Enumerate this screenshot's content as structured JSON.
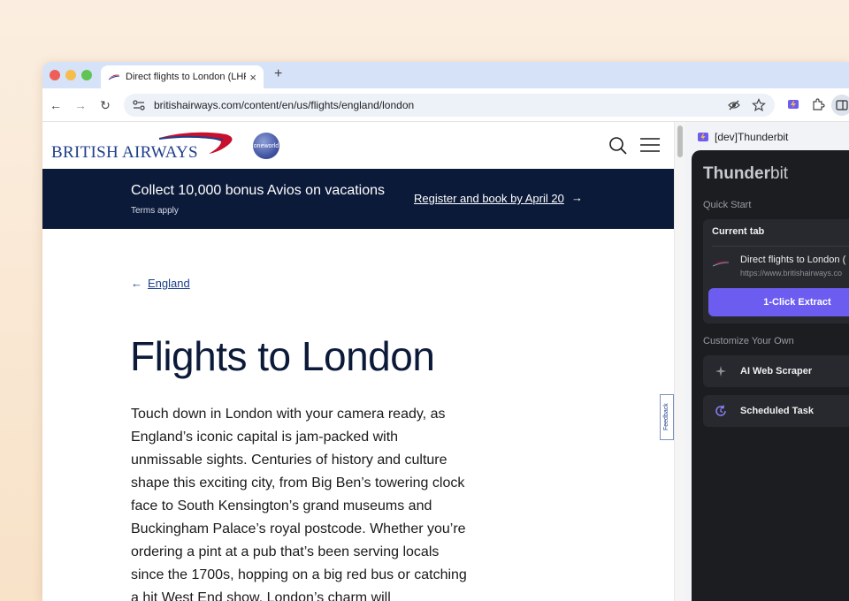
{
  "browser": {
    "tab": {
      "title": "Direct flights to London (LHR",
      "close": "×"
    },
    "new_tab": "+",
    "url": "britishairways.com/content/en/us/flights/england/london",
    "nav": {
      "back": "←",
      "forward": "→",
      "reload": "↻"
    },
    "icons": [
      "eye-off-icon",
      "star-icon",
      "thunderbit-ext-icon",
      "puzzle-icon",
      "side-panel-icon"
    ]
  },
  "ba": {
    "logo_text": "BRITISH AIRWAYS",
    "oneworld_text": "oneworld",
    "promo": {
      "title": "Collect 10,000 bonus Avios on vacations",
      "subtitle": "Terms apply",
      "link": "Register and book by April 20",
      "arrow": "→"
    },
    "breadcrumb": {
      "arrow": "←",
      "label": "England"
    },
    "title": "Flights to London",
    "body": "Touch down in London with your camera ready, as England’s iconic capital is jam-packed with unmissable sights. Centuries of history and culture shape this exciting city, from Big Ben’s towering clock face to South Kensington’s grand museums and Buckingham Palace’s royal postcode. Whether you’re ordering a pint at a pub that’s been serving locals since the 1700s, hopping on a big red bus or catching a hit West End show, London’s charm will",
    "feedback": "Feedback",
    "colors": {
      "navy": "#0c1a3a",
      "brand_blue": "#1e3f8a",
      "brand_red": "#c8102e"
    }
  },
  "side_panel": {
    "header": "[dev]Thunderbit",
    "logo_bold": "Thunder",
    "logo_light": "bit",
    "quick_start": "Quick Start",
    "current_tab": "Current tab",
    "tab_title": "Direct flights to London (",
    "tab_url": "https://www.britishairways.co",
    "extract": "1-Click Extract",
    "customize": "Customize Your Own",
    "ai_scraper": "AI Web Scraper",
    "scheduled_task": "Scheduled Task",
    "colors": {
      "accent": "#6c5cf0",
      "panel_bg": "#1c1d21"
    }
  }
}
